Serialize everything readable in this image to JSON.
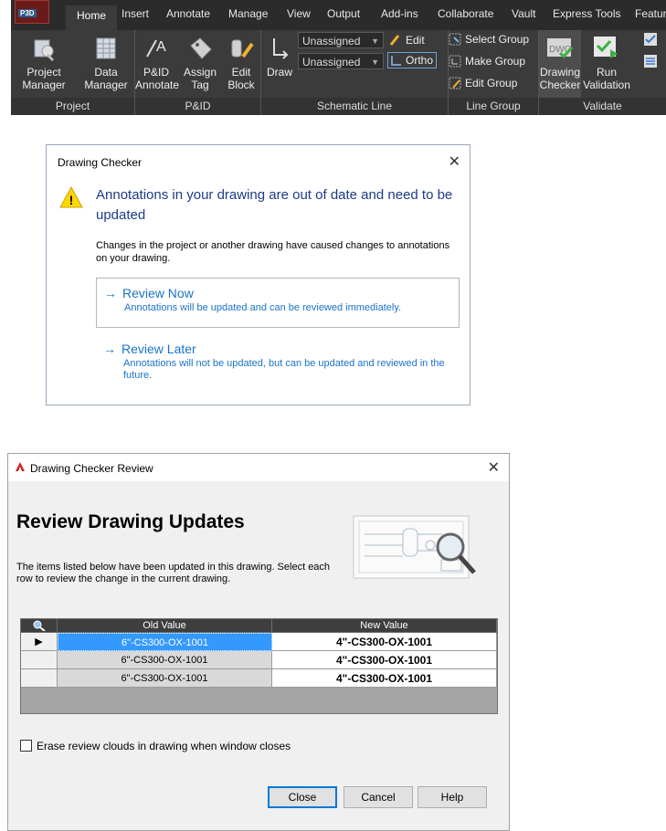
{
  "ribbon": {
    "app_badge": "P3D",
    "tabs": [
      "Home",
      "Insert",
      "Annotate",
      "Manage",
      "View",
      "Output",
      "Add-ins",
      "Collaborate",
      "Vault",
      "Express Tools",
      "Featur"
    ],
    "active_tab": "Home",
    "panels": {
      "project": {
        "title": "Project",
        "project_manager": "Project Manager",
        "data_manager": "Data Manager"
      },
      "pid": {
        "title": "P&ID",
        "pid_annotate": "P&ID Annotate",
        "assign_tag": "Assign Tag",
        "edit_block": "Edit Block"
      },
      "schematic_line": {
        "title": "Schematic Line",
        "draw": "Draw",
        "dropdown1": "Unassigned",
        "dropdown2": "Unassigned",
        "edit": "Edit",
        "ortho": "Ortho"
      },
      "line_group": {
        "title": "Line Group",
        "select_group": "Select Group",
        "make_group": "Make Group",
        "edit_group": "Edit Group"
      },
      "validate": {
        "title": "Validate",
        "drawing_checker": "Drawing Checker",
        "run_validation": "Run Validation",
        "dwg_badge": "DWG"
      }
    }
  },
  "dialog1": {
    "title": "Drawing Checker",
    "heading": "Annotations in your drawing are out of date and need to be updated",
    "body": "Changes in the project or another drawing have caused changes to annotations on your drawing.",
    "options": [
      {
        "label": "Review Now",
        "desc": "Annotations will be updated and can be reviewed immediately."
      },
      {
        "label": "Review Later",
        "desc": "Annotations will not be updated, but can be updated and reviewed in the future."
      }
    ],
    "arrow_glyph": "→",
    "close_glyph": "✕",
    "warn_glyph": "!"
  },
  "dialog2": {
    "title": "Drawing Checker Review",
    "heading": "Review Drawing Updates",
    "description": "The items listed below have been updated in this drawing. Select each row to review the change in the current drawing.",
    "grid": {
      "columns": [
        "Old Value",
        "New Value"
      ],
      "rows": [
        {
          "old": "6\"-CS300-OX-1001",
          "new": "4\"-CS300-OX-1001",
          "current": "▶"
        },
        {
          "old": "6\"-CS300-OX-1001",
          "new": "4\"-CS300-OX-1001",
          "current": ""
        },
        {
          "old": "6\"-CS300-OX-1001",
          "new": "4\"-CS300-OX-1001",
          "current": ""
        }
      ]
    },
    "checkbox_label": "Erase review clouds in drawing when window closes",
    "buttons": {
      "close": "Close",
      "cancel": "Cancel",
      "help": "Help"
    },
    "close_glyph": "✕"
  }
}
